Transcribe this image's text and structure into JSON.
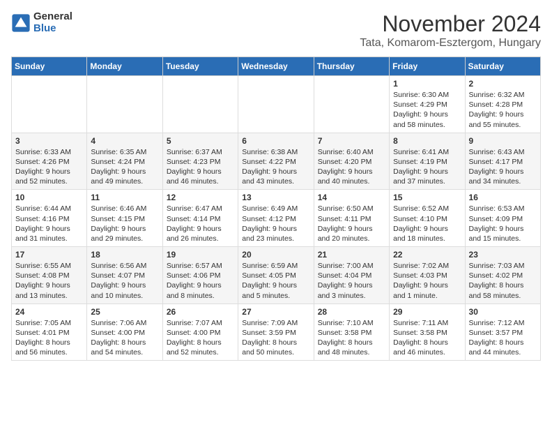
{
  "logo": {
    "general": "General",
    "blue": "Blue"
  },
  "title": "November 2024",
  "subtitle": "Tata, Komarom-Esztergom, Hungary",
  "header": {
    "days": [
      "Sunday",
      "Monday",
      "Tuesday",
      "Wednesday",
      "Thursday",
      "Friday",
      "Saturday"
    ]
  },
  "weeks": [
    {
      "cells": [
        {
          "day": "",
          "info": ""
        },
        {
          "day": "",
          "info": ""
        },
        {
          "day": "",
          "info": ""
        },
        {
          "day": "",
          "info": ""
        },
        {
          "day": "",
          "info": ""
        },
        {
          "day": "1",
          "info": "Sunrise: 6:30 AM\nSunset: 4:29 PM\nDaylight: 9 hours and 58 minutes."
        },
        {
          "day": "2",
          "info": "Sunrise: 6:32 AM\nSunset: 4:28 PM\nDaylight: 9 hours and 55 minutes."
        }
      ]
    },
    {
      "cells": [
        {
          "day": "3",
          "info": "Sunrise: 6:33 AM\nSunset: 4:26 PM\nDaylight: 9 hours and 52 minutes."
        },
        {
          "day": "4",
          "info": "Sunrise: 6:35 AM\nSunset: 4:24 PM\nDaylight: 9 hours and 49 minutes."
        },
        {
          "day": "5",
          "info": "Sunrise: 6:37 AM\nSunset: 4:23 PM\nDaylight: 9 hours and 46 minutes."
        },
        {
          "day": "6",
          "info": "Sunrise: 6:38 AM\nSunset: 4:22 PM\nDaylight: 9 hours and 43 minutes."
        },
        {
          "day": "7",
          "info": "Sunrise: 6:40 AM\nSunset: 4:20 PM\nDaylight: 9 hours and 40 minutes."
        },
        {
          "day": "8",
          "info": "Sunrise: 6:41 AM\nSunset: 4:19 PM\nDaylight: 9 hours and 37 minutes."
        },
        {
          "day": "9",
          "info": "Sunrise: 6:43 AM\nSunset: 4:17 PM\nDaylight: 9 hours and 34 minutes."
        }
      ]
    },
    {
      "cells": [
        {
          "day": "10",
          "info": "Sunrise: 6:44 AM\nSunset: 4:16 PM\nDaylight: 9 hours and 31 minutes."
        },
        {
          "day": "11",
          "info": "Sunrise: 6:46 AM\nSunset: 4:15 PM\nDaylight: 9 hours and 29 minutes."
        },
        {
          "day": "12",
          "info": "Sunrise: 6:47 AM\nSunset: 4:14 PM\nDaylight: 9 hours and 26 minutes."
        },
        {
          "day": "13",
          "info": "Sunrise: 6:49 AM\nSunset: 4:12 PM\nDaylight: 9 hours and 23 minutes."
        },
        {
          "day": "14",
          "info": "Sunrise: 6:50 AM\nSunset: 4:11 PM\nDaylight: 9 hours and 20 minutes."
        },
        {
          "day": "15",
          "info": "Sunrise: 6:52 AM\nSunset: 4:10 PM\nDaylight: 9 hours and 18 minutes."
        },
        {
          "day": "16",
          "info": "Sunrise: 6:53 AM\nSunset: 4:09 PM\nDaylight: 9 hours and 15 minutes."
        }
      ]
    },
    {
      "cells": [
        {
          "day": "17",
          "info": "Sunrise: 6:55 AM\nSunset: 4:08 PM\nDaylight: 9 hours and 13 minutes."
        },
        {
          "day": "18",
          "info": "Sunrise: 6:56 AM\nSunset: 4:07 PM\nDaylight: 9 hours and 10 minutes."
        },
        {
          "day": "19",
          "info": "Sunrise: 6:57 AM\nSunset: 4:06 PM\nDaylight: 9 hours and 8 minutes."
        },
        {
          "day": "20",
          "info": "Sunrise: 6:59 AM\nSunset: 4:05 PM\nDaylight: 9 hours and 5 minutes."
        },
        {
          "day": "21",
          "info": "Sunrise: 7:00 AM\nSunset: 4:04 PM\nDaylight: 9 hours and 3 minutes."
        },
        {
          "day": "22",
          "info": "Sunrise: 7:02 AM\nSunset: 4:03 PM\nDaylight: 9 hours and 1 minute."
        },
        {
          "day": "23",
          "info": "Sunrise: 7:03 AM\nSunset: 4:02 PM\nDaylight: 8 hours and 58 minutes."
        }
      ]
    },
    {
      "cells": [
        {
          "day": "24",
          "info": "Sunrise: 7:05 AM\nSunset: 4:01 PM\nDaylight: 8 hours and 56 minutes."
        },
        {
          "day": "25",
          "info": "Sunrise: 7:06 AM\nSunset: 4:00 PM\nDaylight: 8 hours and 54 minutes."
        },
        {
          "day": "26",
          "info": "Sunrise: 7:07 AM\nSunset: 4:00 PM\nDaylight: 8 hours and 52 minutes."
        },
        {
          "day": "27",
          "info": "Sunrise: 7:09 AM\nSunset: 3:59 PM\nDaylight: 8 hours and 50 minutes."
        },
        {
          "day": "28",
          "info": "Sunrise: 7:10 AM\nSunset: 3:58 PM\nDaylight: 8 hours and 48 minutes."
        },
        {
          "day": "29",
          "info": "Sunrise: 7:11 AM\nSunset: 3:58 PM\nDaylight: 8 hours and 46 minutes."
        },
        {
          "day": "30",
          "info": "Sunrise: 7:12 AM\nSunset: 3:57 PM\nDaylight: 8 hours and 44 minutes."
        }
      ]
    }
  ]
}
